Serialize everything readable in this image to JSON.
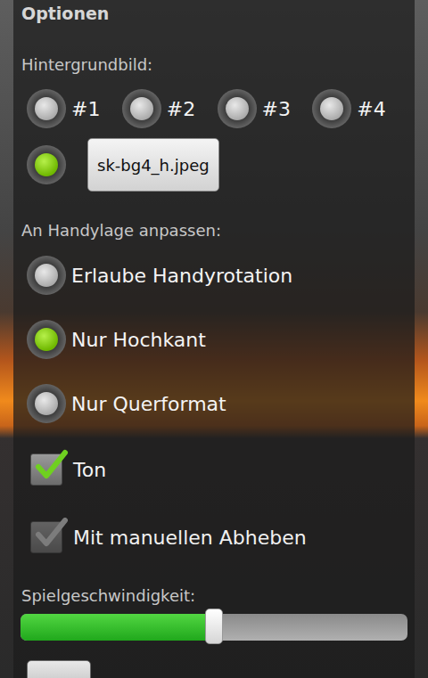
{
  "title": "Optionen",
  "background": {
    "label": "Hintergrundbild:",
    "options": [
      {
        "label": "#1",
        "selected": false
      },
      {
        "label": "#2",
        "selected": false
      },
      {
        "label": "#3",
        "selected": false
      },
      {
        "label": "#4",
        "selected": false
      }
    ],
    "custom": {
      "selected": true,
      "button": "sk-bg4_h.jpeg"
    }
  },
  "orientation": {
    "label": "An Handylage anpassen:",
    "options": [
      {
        "label": "Erlaube Handyrotation",
        "selected": false
      },
      {
        "label": "Nur Hochkant",
        "selected": true
      },
      {
        "label": "Nur Querformat",
        "selected": false
      }
    ]
  },
  "checkboxes": [
    {
      "label": "Ton",
      "checked": true,
      "disabled": false
    },
    {
      "label": "Mit manuellen Abheben",
      "checked": true,
      "disabled": true
    }
  ],
  "speed": {
    "label": "Spielgeschwindigkeit:",
    "level": 0.5
  }
}
